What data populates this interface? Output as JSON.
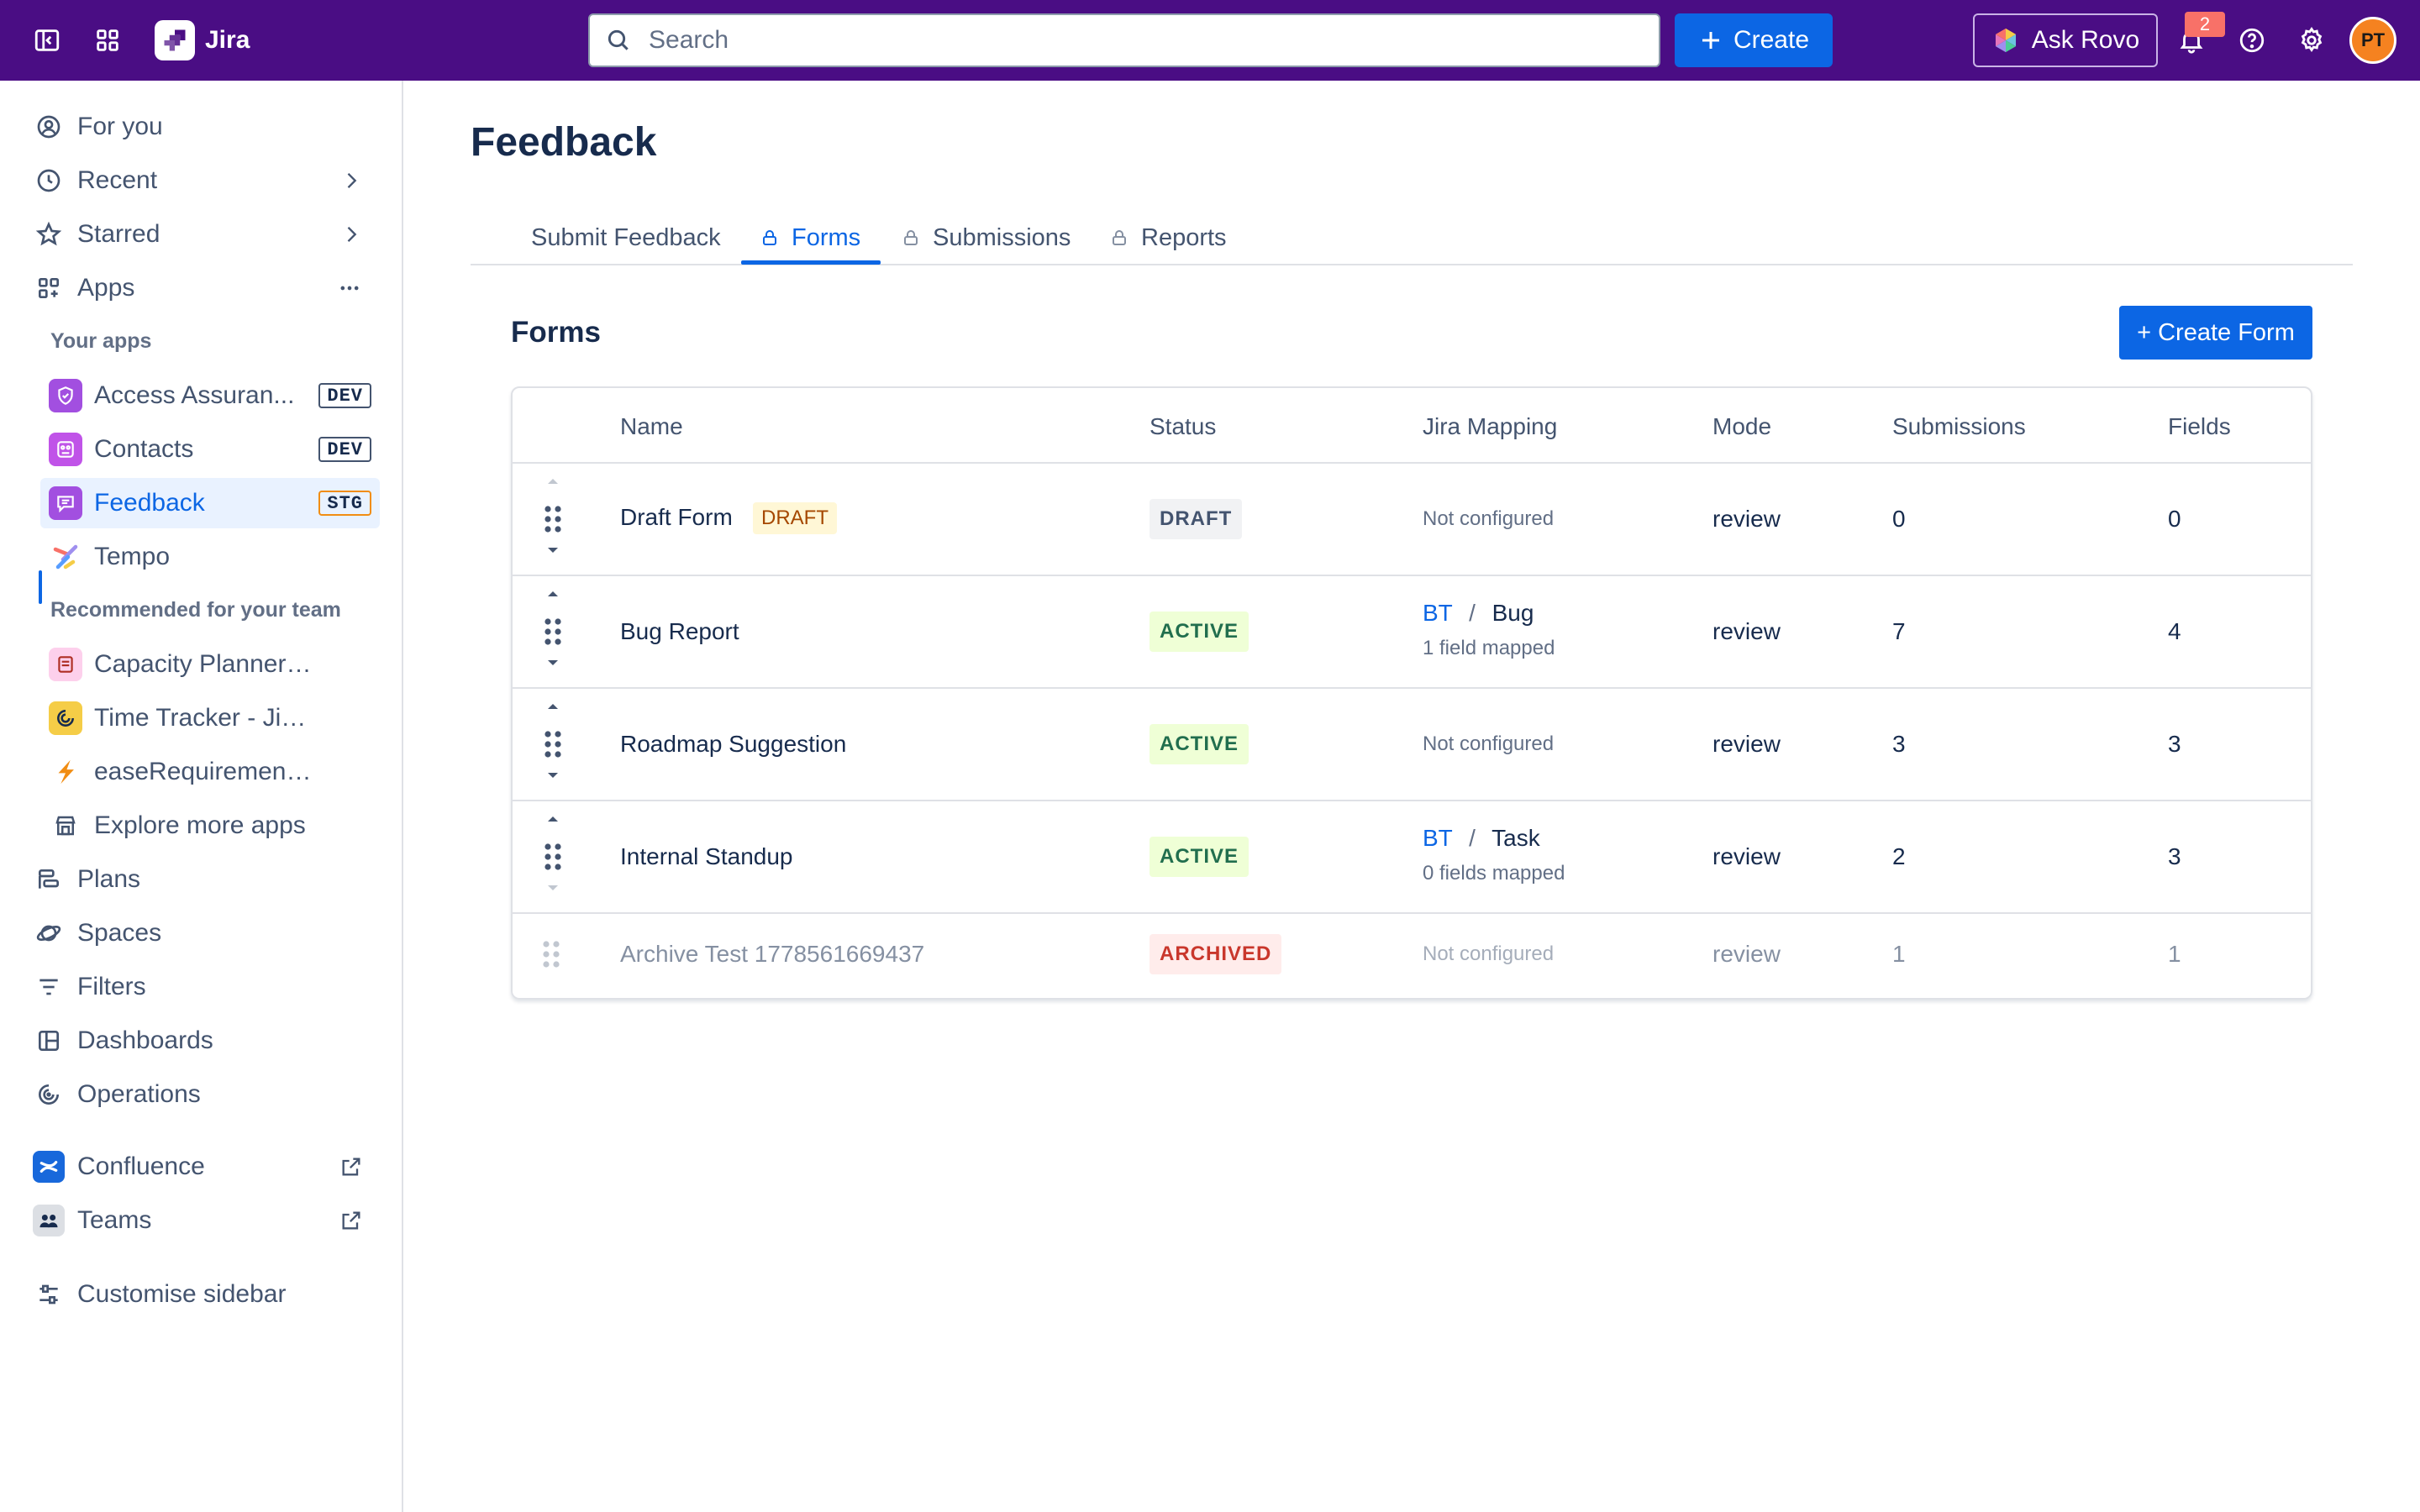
{
  "topbar": {
    "app_name": "Jira",
    "search_placeholder": "Search",
    "create_label": "Create",
    "ask_rovo_label": "Ask Rovo",
    "notification_count": "2",
    "avatar_initials": "PT"
  },
  "sidebar": {
    "for_you": "For you",
    "recent": "Recent",
    "starred": "Starred",
    "apps": "Apps",
    "your_apps_label": "Your apps",
    "your_apps": [
      {
        "label": "Access Assuran...",
        "env": "DEV"
      },
      {
        "label": "Contacts",
        "env": "DEV"
      },
      {
        "label": "Feedback",
        "env": "STG"
      },
      {
        "label": "Tempo",
        "env": ""
      }
    ],
    "recommended_label": "Recommended for your team",
    "recommended": [
      {
        "label": "Capacity Planner - Jir..."
      },
      {
        "label": "Time Tracker - Jira Ti..."
      },
      {
        "label": "easeRequirements - ..."
      },
      {
        "label": "Explore more apps"
      }
    ],
    "plans": "Plans",
    "spaces": "Spaces",
    "filters": "Filters",
    "dashboards": "Dashboards",
    "operations": "Operations",
    "confluence": "Confluence",
    "teams": "Teams",
    "customise": "Customise sidebar"
  },
  "page": {
    "title": "Feedback",
    "tabs": [
      {
        "label": "Submit Feedback"
      },
      {
        "label": "Forms"
      },
      {
        "label": "Submissions"
      },
      {
        "label": "Reports"
      }
    ],
    "forms_heading": "Forms",
    "create_form_label": "+ Create Form"
  },
  "table": {
    "headers": {
      "name": "Name",
      "status": "Status",
      "mapping": "Jira Mapping",
      "mode": "Mode",
      "submissions": "Submissions",
      "fields": "Fields"
    },
    "rows": [
      {
        "name": "Draft Form",
        "inline_badge": "DRAFT",
        "status": "DRAFT",
        "mapping": "Not configured",
        "mode": "review",
        "submissions": "0",
        "fields": "0"
      },
      {
        "name": "Bug Report",
        "status": "ACTIVE",
        "mapping_project": "BT",
        "mapping_sep": "/",
        "mapping_type": "Bug",
        "mapping_sub": "1 field mapped",
        "mode": "review",
        "submissions": "7",
        "fields": "4"
      },
      {
        "name": "Roadmap Suggestion",
        "status": "ACTIVE",
        "mapping": "Not configured",
        "mode": "review",
        "submissions": "3",
        "fields": "3"
      },
      {
        "name": "Internal Standup",
        "status": "ACTIVE",
        "mapping_project": "BT",
        "mapping_sep": "/",
        "mapping_type": "Task",
        "mapping_sub": "0 fields mapped",
        "mode": "review",
        "submissions": "2",
        "fields": "3"
      },
      {
        "name": "Archive Test 1778561669437",
        "status": "ARCHIVED",
        "mapping": "Not configured",
        "mode": "review",
        "submissions": "1",
        "fields": "1"
      }
    ]
  },
  "colors": {
    "topbar_bg": "#4a0d84",
    "primary": "#0c66e4",
    "active_green": "#216e4e",
    "archived_red": "#c9372c"
  }
}
